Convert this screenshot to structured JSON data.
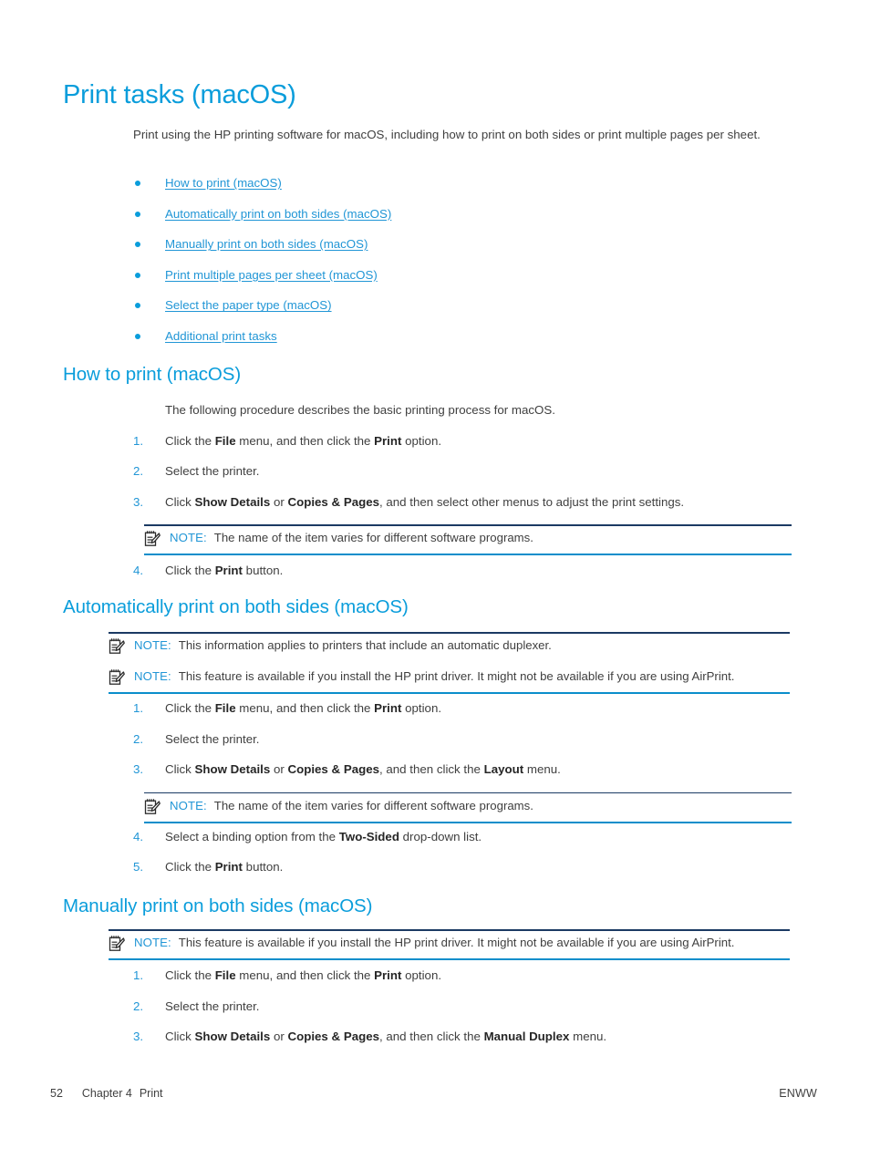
{
  "page": {
    "title": "Print tasks (macOS)",
    "intro": "Print using the HP printing software for macOS, including how to print on both sides or print multiple pages per sheet."
  },
  "toc": {
    "links": [
      {
        "label": "How to print (macOS)"
      },
      {
        "label": "Automatically print on both sides (macOS)"
      },
      {
        "label": "Manually print on both sides (macOS)"
      },
      {
        "label": "Print multiple pages per sheet (macOS)"
      },
      {
        "label": "Select the paper type (macOS)"
      },
      {
        "label": "Additional print tasks"
      }
    ]
  },
  "icons": {
    "note": "notepad-pencil-icon",
    "bullet": "bullet-dot-icon"
  },
  "labels": {
    "note": "NOTE:"
  },
  "sections": {
    "how_to_print": {
      "heading": "How to print (macOS)",
      "lead": "The following procedure describes the basic printing process for macOS.",
      "steps": [
        {
          "num": "1.",
          "pre": "Click the ",
          "b1": "File",
          "mid": " menu, and then click the ",
          "b2": "Print",
          "post": " option."
        },
        {
          "num": "2.",
          "pre": "Select the printer.",
          "b1": "",
          "mid": "",
          "b2": "",
          "post": ""
        },
        {
          "num": "3.",
          "pre": "Click ",
          "b1": "Show Details",
          "mid": " or ",
          "b2": "Copies & Pages",
          "post": ", and then select other menus to adjust the print settings."
        },
        {
          "num": "4.",
          "pre": "Click the ",
          "b1": "Print",
          "mid": " button.",
          "b2": "",
          "post": ""
        }
      ],
      "note": "The name of the item varies for different software programs."
    },
    "auto_duplex": {
      "heading": "Automatically print on both sides (macOS)",
      "note1": "This information applies to printers that include an automatic duplexer.",
      "note2": "This feature is available if you install the HP print driver. It might not be available if you are using AirPrint.",
      "steps": [
        {
          "num": "1.",
          "pre": "Click the ",
          "b1": "File",
          "mid": " menu, and then click the ",
          "b2": "Print",
          "post": " option."
        },
        {
          "num": "2.",
          "pre": "Select the printer.",
          "b1": "",
          "mid": "",
          "b2": "",
          "post": ""
        },
        {
          "num": "3.",
          "pre": "Click ",
          "b1": "Show Details",
          "mid": " or ",
          "b2": "Copies & Pages",
          "post": ", and then click the ",
          "b3": "Layout",
          "post2": " menu."
        },
        {
          "num": "4.",
          "pre": "Select a binding option from the ",
          "b1": "Two-Sided",
          "mid": " drop-down list.",
          "b2": "",
          "post": ""
        },
        {
          "num": "5.",
          "pre": "Click the ",
          "b1": "Print",
          "mid": " button.",
          "b2": "",
          "post": ""
        }
      ],
      "note3": "The name of the item varies for different software programs."
    },
    "manual_duplex": {
      "heading": "Manually print on both sides (macOS)",
      "note1": "This feature is available if you install the HP print driver. It might not be available if you are using AirPrint.",
      "steps": [
        {
          "num": "1.",
          "pre": "Click the ",
          "b1": "File",
          "mid": " menu, and then click the ",
          "b2": "Print",
          "post": " option."
        },
        {
          "num": "2.",
          "pre": "Select the printer.",
          "b1": "",
          "mid": "",
          "b2": "",
          "post": ""
        },
        {
          "num": "3.",
          "pre": "Click ",
          "b1": "Show Details",
          "mid": " or ",
          "b2": "Copies & Pages",
          "post": ", and then click the ",
          "b3": "Manual Duplex",
          "post2": " menu."
        }
      ]
    }
  },
  "footer": {
    "page_number": "52",
    "chapter": "Chapter 4",
    "chapter_title": "Print",
    "edition": "ENWW"
  },
  "colors": {
    "heading_blue": "#0a9ddb",
    "link_blue": "#2196d6",
    "body_gray": "#3f3f3f",
    "rule_dark": "#1b3a63",
    "rule_light": "#0a8ecb"
  }
}
